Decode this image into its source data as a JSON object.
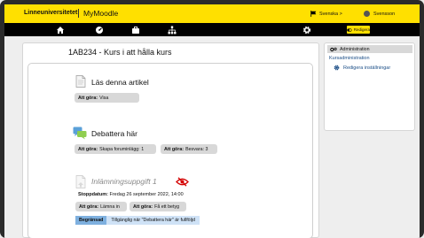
{
  "header": {
    "logo_text": "Linneuniversitetet",
    "site_name": "MyMoodle",
    "language": "Svenska >",
    "user_name": "Svensson"
  },
  "navbar": {
    "icons": [
      "home-icon",
      "dashboard-icon",
      "briefcase-icon",
      "sitemap-icon",
      "gear-icon"
    ],
    "edit_label": "Redigera"
  },
  "course": {
    "title": "1AB234 - Kurs i att hålla kurs",
    "activities": [
      {
        "title": "Läs denna artikel",
        "icon": "page-icon",
        "todos": [
          {
            "label": "Att göra:",
            "value": "Visa"
          }
        ]
      },
      {
        "title": "Debattera här",
        "icon": "forum-icon",
        "todos": [
          {
            "label": "Att göra:",
            "value": "Skapa foruminlägg: 1"
          },
          {
            "label": "Att göra:",
            "value": "Besvara: 3"
          }
        ]
      },
      {
        "title": "Inlämningsuppgift 1",
        "icon": "assignment-icon",
        "hidden_icon": "eye-slash-icon",
        "deadline_label": "Stoppdatum:",
        "deadline_value": "Fredag 26 september 2022, 14:00",
        "todos": [
          {
            "label": "Att göra:",
            "value": "Lämna in"
          },
          {
            "label": "Att göra:",
            "value": "Få ett betyg"
          }
        ],
        "restriction_tag": "Begränsad",
        "restriction_text": "Tillgänglig när \"Debattera här\" är fullföljd"
      }
    ]
  },
  "administration": {
    "title": "Administration",
    "link": "Kursadministration",
    "sub_link": "Redigera inställningar"
  },
  "colors": {
    "brand_yellow": "#ffe000",
    "restriction_tag": "#7eb0df",
    "restriction_bg": "#cfe2f6",
    "hidden_icon": "#d40000"
  }
}
